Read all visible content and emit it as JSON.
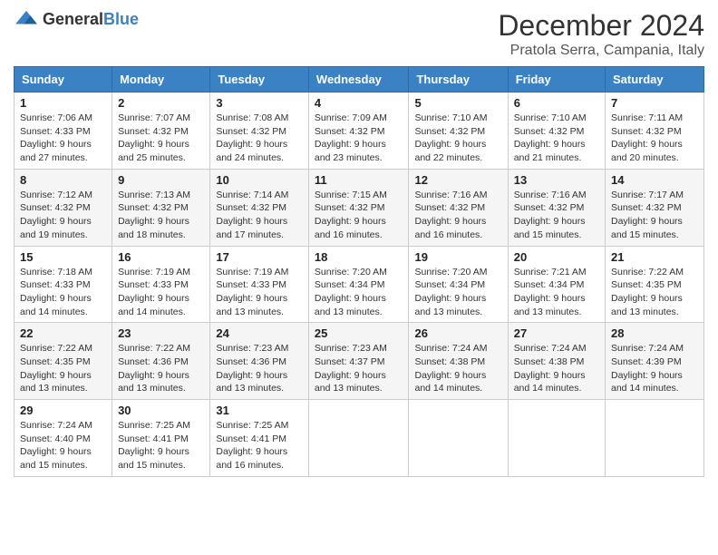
{
  "logo": {
    "general": "General",
    "blue": "Blue"
  },
  "title": "December 2024",
  "subtitle": "Pratola Serra, Campania, Italy",
  "days_of_week": [
    "Sunday",
    "Monday",
    "Tuesday",
    "Wednesday",
    "Thursday",
    "Friday",
    "Saturday"
  ],
  "weeks": [
    [
      {
        "day": "1",
        "sunrise": "7:06 AM",
        "sunset": "4:33 PM",
        "daylight": "9 hours and 27 minutes."
      },
      {
        "day": "2",
        "sunrise": "7:07 AM",
        "sunset": "4:32 PM",
        "daylight": "9 hours and 25 minutes."
      },
      {
        "day": "3",
        "sunrise": "7:08 AM",
        "sunset": "4:32 PM",
        "daylight": "9 hours and 24 minutes."
      },
      {
        "day": "4",
        "sunrise": "7:09 AM",
        "sunset": "4:32 PM",
        "daylight": "9 hours and 23 minutes."
      },
      {
        "day": "5",
        "sunrise": "7:10 AM",
        "sunset": "4:32 PM",
        "daylight": "9 hours and 22 minutes."
      },
      {
        "day": "6",
        "sunrise": "7:10 AM",
        "sunset": "4:32 PM",
        "daylight": "9 hours and 21 minutes."
      },
      {
        "day": "7",
        "sunrise": "7:11 AM",
        "sunset": "4:32 PM",
        "daylight": "9 hours and 20 minutes."
      }
    ],
    [
      {
        "day": "8",
        "sunrise": "7:12 AM",
        "sunset": "4:32 PM",
        "daylight": "9 hours and 19 minutes."
      },
      {
        "day": "9",
        "sunrise": "7:13 AM",
        "sunset": "4:32 PM",
        "daylight": "9 hours and 18 minutes."
      },
      {
        "day": "10",
        "sunrise": "7:14 AM",
        "sunset": "4:32 PM",
        "daylight": "9 hours and 17 minutes."
      },
      {
        "day": "11",
        "sunrise": "7:15 AM",
        "sunset": "4:32 PM",
        "daylight": "9 hours and 16 minutes."
      },
      {
        "day": "12",
        "sunrise": "7:16 AM",
        "sunset": "4:32 PM",
        "daylight": "9 hours and 16 minutes."
      },
      {
        "day": "13",
        "sunrise": "7:16 AM",
        "sunset": "4:32 PM",
        "daylight": "9 hours and 15 minutes."
      },
      {
        "day": "14",
        "sunrise": "7:17 AM",
        "sunset": "4:32 PM",
        "daylight": "9 hours and 15 minutes."
      }
    ],
    [
      {
        "day": "15",
        "sunrise": "7:18 AM",
        "sunset": "4:33 PM",
        "daylight": "9 hours and 14 minutes."
      },
      {
        "day": "16",
        "sunrise": "7:19 AM",
        "sunset": "4:33 PM",
        "daylight": "9 hours and 14 minutes."
      },
      {
        "day": "17",
        "sunrise": "7:19 AM",
        "sunset": "4:33 PM",
        "daylight": "9 hours and 13 minutes."
      },
      {
        "day": "18",
        "sunrise": "7:20 AM",
        "sunset": "4:34 PM",
        "daylight": "9 hours and 13 minutes."
      },
      {
        "day": "19",
        "sunrise": "7:20 AM",
        "sunset": "4:34 PM",
        "daylight": "9 hours and 13 minutes."
      },
      {
        "day": "20",
        "sunrise": "7:21 AM",
        "sunset": "4:34 PM",
        "daylight": "9 hours and 13 minutes."
      },
      {
        "day": "21",
        "sunrise": "7:22 AM",
        "sunset": "4:35 PM",
        "daylight": "9 hours and 13 minutes."
      }
    ],
    [
      {
        "day": "22",
        "sunrise": "7:22 AM",
        "sunset": "4:35 PM",
        "daylight": "9 hours and 13 minutes."
      },
      {
        "day": "23",
        "sunrise": "7:22 AM",
        "sunset": "4:36 PM",
        "daylight": "9 hours and 13 minutes."
      },
      {
        "day": "24",
        "sunrise": "7:23 AM",
        "sunset": "4:36 PM",
        "daylight": "9 hours and 13 minutes."
      },
      {
        "day": "25",
        "sunrise": "7:23 AM",
        "sunset": "4:37 PM",
        "daylight": "9 hours and 13 minutes."
      },
      {
        "day": "26",
        "sunrise": "7:24 AM",
        "sunset": "4:38 PM",
        "daylight": "9 hours and 14 minutes."
      },
      {
        "day": "27",
        "sunrise": "7:24 AM",
        "sunset": "4:38 PM",
        "daylight": "9 hours and 14 minutes."
      },
      {
        "day": "28",
        "sunrise": "7:24 AM",
        "sunset": "4:39 PM",
        "daylight": "9 hours and 14 minutes."
      }
    ],
    [
      {
        "day": "29",
        "sunrise": "7:24 AM",
        "sunset": "4:40 PM",
        "daylight": "9 hours and 15 minutes."
      },
      {
        "day": "30",
        "sunrise": "7:25 AM",
        "sunset": "4:41 PM",
        "daylight": "9 hours and 15 minutes."
      },
      {
        "day": "31",
        "sunrise": "7:25 AM",
        "sunset": "4:41 PM",
        "daylight": "9 hours and 16 minutes."
      },
      null,
      null,
      null,
      null
    ]
  ],
  "labels": {
    "sunrise": "Sunrise:",
    "sunset": "Sunset:",
    "daylight": "Daylight:"
  },
  "colors": {
    "header_bg": "#3b82c4",
    "header_text": "#ffffff"
  }
}
